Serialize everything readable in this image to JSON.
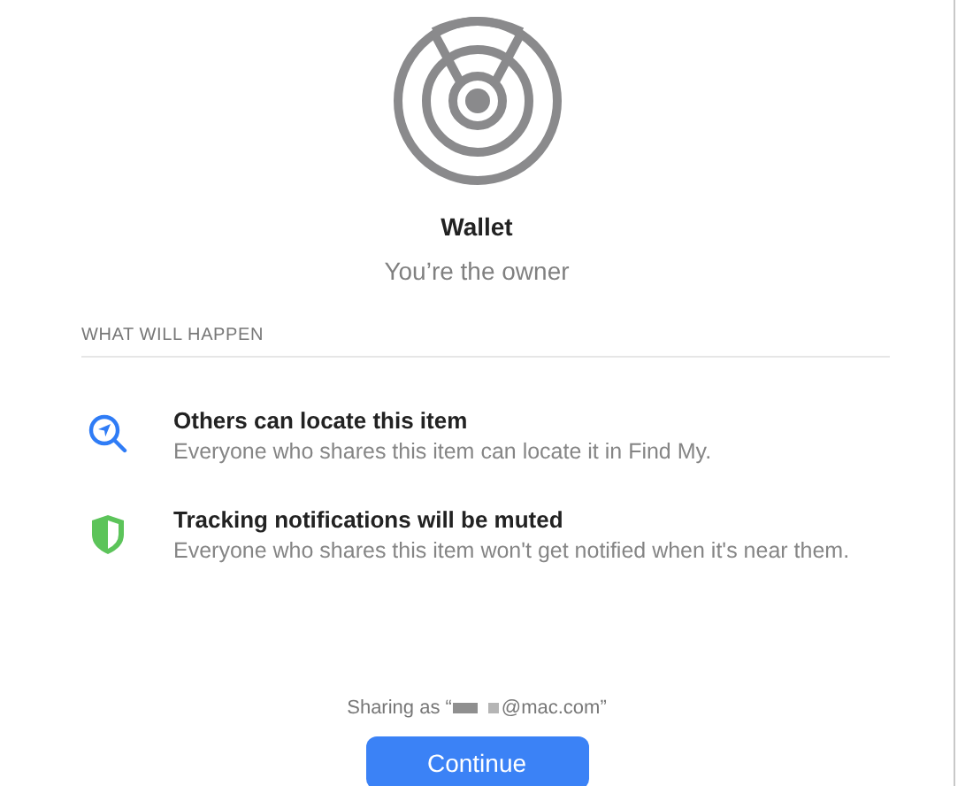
{
  "item": {
    "title": "Wallet",
    "subtitle": "You’re the owner"
  },
  "section_header": "WHAT WILL HAPPEN",
  "effects": [
    {
      "kind": "locate",
      "title": "Others can locate this item",
      "description": "Everyone who shares this item can locate it in Find My."
    },
    {
      "kind": "muted",
      "title": "Tracking notifications will be muted",
      "description": "Everyone who shares this item won't get notified when it's near them."
    }
  ],
  "sharing": {
    "prefix": "Sharing as “",
    "suffix": "@mac.com”"
  },
  "buttons": [
    "Continue"
  ]
}
